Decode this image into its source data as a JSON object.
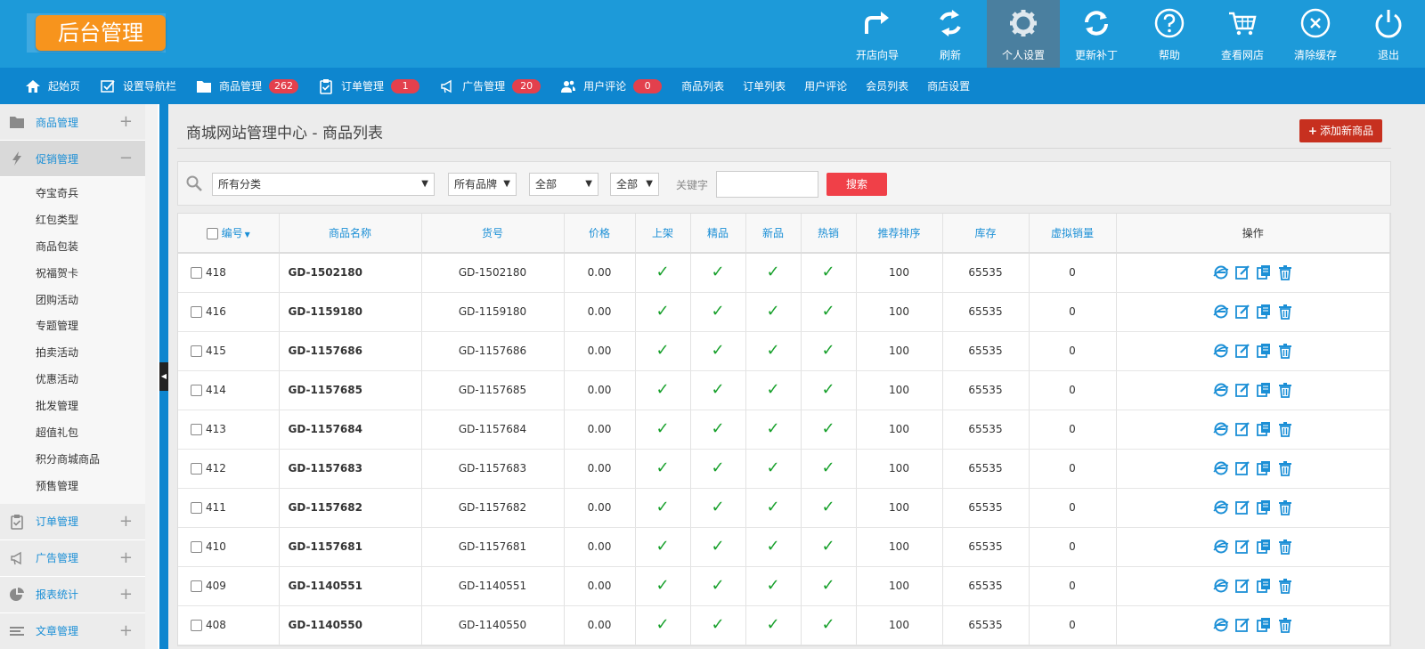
{
  "app": {
    "logo": "后台管理"
  },
  "top_actions": [
    {
      "label": "开店向导",
      "icon": "redo-arrow-icon",
      "active": false
    },
    {
      "label": "刷新",
      "icon": "refresh-icon",
      "active": false
    },
    {
      "label": "个人设置",
      "icon": "gear-icon",
      "active": true
    },
    {
      "label": "更新补丁",
      "icon": "sync-icon",
      "active": false
    },
    {
      "label": "帮助",
      "icon": "help-icon",
      "active": false
    },
    {
      "label": "查看网店",
      "icon": "cart-icon",
      "active": false
    },
    {
      "label": "清除缓存",
      "icon": "clear-icon",
      "active": false
    },
    {
      "label": "退出",
      "icon": "power-icon",
      "active": false
    }
  ],
  "navbar": {
    "items": [
      {
        "label": "起始页",
        "icon": "home-icon",
        "badge": null
      },
      {
        "label": "设置导航栏",
        "icon": "checkbox-icon",
        "badge": null
      },
      {
        "label": "商品管理",
        "icon": "folder-icon",
        "badge": "262"
      },
      {
        "label": "订单管理",
        "icon": "clipboard-icon",
        "badge": "1"
      },
      {
        "label": "广告管理",
        "icon": "megaphone-icon",
        "badge": "20"
      },
      {
        "label": "用户评论",
        "icon": "users-icon",
        "badge": "0"
      }
    ],
    "links": [
      "商品列表",
      "订单列表",
      "用户评论",
      "会员列表",
      "商店设置"
    ]
  },
  "sidebar": {
    "groups": [
      {
        "label": "商品管理",
        "icon": "folder-icon",
        "toggle": "+",
        "open": false
      },
      {
        "label": "促销管理",
        "icon": "bolt-icon",
        "toggle": "−",
        "open": true,
        "items": [
          "夺宝奇兵",
          "红包类型",
          "商品包装",
          "祝福贺卡",
          "团购活动",
          "专题管理",
          "拍卖活动",
          "优惠活动",
          "批发管理",
          "超值礼包",
          "积分商城商品",
          "预售管理"
        ]
      },
      {
        "label": "订单管理",
        "icon": "clipboard-icon",
        "toggle": "+",
        "open": false
      },
      {
        "label": "广告管理",
        "icon": "megaphone-icon",
        "toggle": "+",
        "open": false
      },
      {
        "label": "报表统计",
        "icon": "pie-chart-icon",
        "toggle": "+",
        "open": false
      },
      {
        "label": "文章管理",
        "icon": "list-icon",
        "toggle": "+",
        "open": false
      }
    ]
  },
  "main": {
    "title": "商城网站管理中心 - 商品列表",
    "add_button": "添加新商品",
    "filter": {
      "category": "所有分类",
      "brand": "所有品牌",
      "status1": "全部",
      "status2": "全部",
      "keyword_label": "关键字",
      "search_button": "搜索"
    },
    "columns": [
      "编号",
      "商品名称",
      "货号",
      "价格",
      "上架",
      "精品",
      "新品",
      "热销",
      "推荐排序",
      "库存",
      "虚拟销量",
      "操作"
    ],
    "rows": [
      {
        "id": "418",
        "name": "GD-1502180",
        "sn": "GD-1502180",
        "price": "0.00",
        "sort": "100",
        "stock": "65535",
        "virtual": "0"
      },
      {
        "id": "416",
        "name": "GD-1159180",
        "sn": "GD-1159180",
        "price": "0.00",
        "sort": "100",
        "stock": "65535",
        "virtual": "0"
      },
      {
        "id": "415",
        "name": "GD-1157686",
        "sn": "GD-1157686",
        "price": "0.00",
        "sort": "100",
        "stock": "65535",
        "virtual": "0"
      },
      {
        "id": "414",
        "name": "GD-1157685",
        "sn": "GD-1157685",
        "price": "0.00",
        "sort": "100",
        "stock": "65535",
        "virtual": "0"
      },
      {
        "id": "413",
        "name": "GD-1157684",
        "sn": "GD-1157684",
        "price": "0.00",
        "sort": "100",
        "stock": "65535",
        "virtual": "0"
      },
      {
        "id": "412",
        "name": "GD-1157683",
        "sn": "GD-1157683",
        "price": "0.00",
        "sort": "100",
        "stock": "65535",
        "virtual": "0"
      },
      {
        "id": "411",
        "name": "GD-1157682",
        "sn": "GD-1157682",
        "price": "0.00",
        "sort": "100",
        "stock": "65535",
        "virtual": "0"
      },
      {
        "id": "410",
        "name": "GD-1157681",
        "sn": "GD-1157681",
        "price": "0.00",
        "sort": "100",
        "stock": "65535",
        "virtual": "0"
      },
      {
        "id": "409",
        "name": "GD-1140551",
        "sn": "GD-1140551",
        "price": "0.00",
        "sort": "100",
        "stock": "65535",
        "virtual": "0"
      },
      {
        "id": "408",
        "name": "GD-1140550",
        "sn": "GD-1140550",
        "price": "0.00",
        "sort": "100",
        "stock": "65535",
        "virtual": "0"
      }
    ]
  },
  "colors": {
    "header": "#1d9ad9",
    "nav": "#0e86cf",
    "logo": "#f7941d",
    "accent": "#1b8fd6",
    "check": "#17a02b",
    "danger": "#c7301f"
  }
}
